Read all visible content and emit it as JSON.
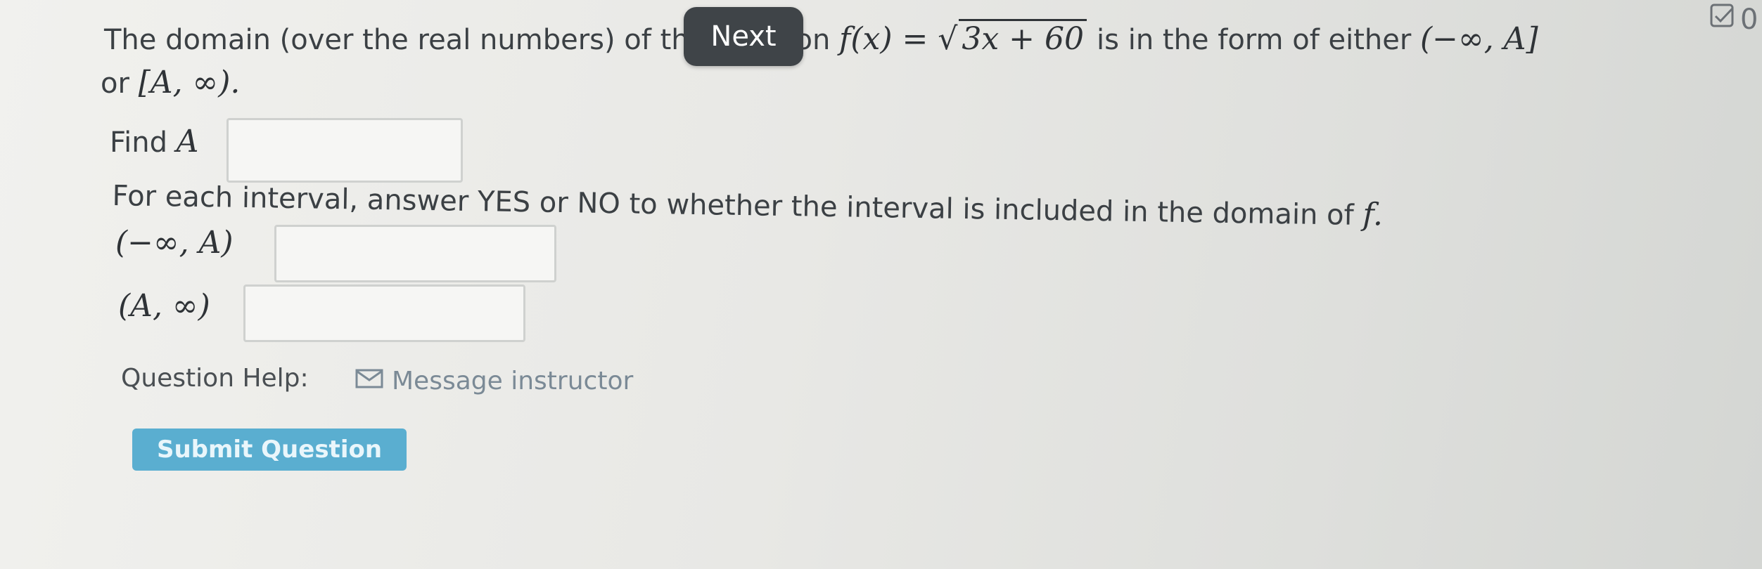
{
  "question": {
    "intro_text": "The domain (over the real numbers) of the function",
    "function_lhs": "f(x) =",
    "function_radicand": "3x + 60",
    "form_text": "is in the form of either",
    "interval_left_form": "(−∞, A]",
    "or_text": "or",
    "interval_right_form": "[A, ∞).",
    "find_label": "Find",
    "find_var": "A",
    "instructions": "For each interval, answer YES or NO to whether the interval is included in the domain of",
    "instructions_var": "f.",
    "interval_1": "(−∞, A)",
    "interval_2": "(A, ∞)"
  },
  "inputs": {
    "find_a_value": "",
    "interval_1_answer": "",
    "interval_2_answer": ""
  },
  "navigation": {
    "next_label": "Next"
  },
  "help": {
    "label": "Question Help:",
    "message_link": "Message instructor"
  },
  "submit": {
    "label": "Submit Question"
  },
  "corner": {
    "score_text": "0"
  },
  "colors": {
    "submit_bg": "#5aaed0",
    "next_bg": "#3f4448",
    "link": "#7b8a96"
  }
}
